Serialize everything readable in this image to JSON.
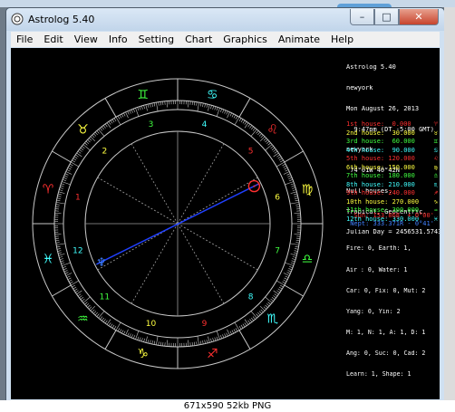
{
  "window": {
    "title": "Astrolog 5.40",
    "buttons": {
      "minimize": "–",
      "maximize": "□",
      "close": "✕"
    }
  },
  "menu": [
    "File",
    "Edit",
    "View",
    "Info",
    "Setting",
    "Chart",
    "Graphics",
    "Animate",
    "Help"
  ],
  "info_lines": [
    "Astrolog 5.40",
    "newyork",
    "Mon August 26, 2013",
    "  9:47pm (DT -5:00 GMT)",
    "newyork",
    " 74°01W 40°42N",
    "Null houses.",
    "Tropical, Geocentric.",
    "Julian Day = 2456531.5743"
  ],
  "houses": [
    {
      "label": "1st house:  ",
      "value": "0.000",
      "color": "#ff3030",
      "sym": "♈"
    },
    {
      "label": "2nd house:  ",
      "value": "30.000",
      "color": "#ffff40",
      "sym": "♉"
    },
    {
      "label": "3rd house:  ",
      "value": "60.000",
      "color": "#40ff40",
      "sym": "♊"
    },
    {
      "label": "4th house:  ",
      "value": "90.000",
      "color": "#40ffff",
      "sym": "♋"
    },
    {
      "label": "5th house: ",
      "value": "120.000",
      "color": "#ff3030",
      "sym": "♌"
    },
    {
      "label": "6th house: ",
      "value": "150.000",
      "color": "#ffff40",
      "sym": "♍"
    },
    {
      "label": "7th house: ",
      "value": "180.000",
      "color": "#40ff40",
      "sym": "♎"
    },
    {
      "label": "8th house: ",
      "value": "210.000",
      "color": "#40ffff",
      "sym": "♏"
    },
    {
      "label": "9th house: ",
      "value": "240.000",
      "color": "#ff3030",
      "sym": "♐"
    },
    {
      "label": "10th house: ",
      "value": "270.000",
      "color": "#ffff40",
      "sym": "♑"
    },
    {
      "label": "11th house: ",
      "value": "300.000",
      "color": "#40ff40",
      "sym": "♒"
    },
    {
      "label": "12th house: ",
      "value": "330.000",
      "color": "#40ffff",
      "sym": "♓"
    }
  ],
  "planets": [
    {
      "text": "  Sun: 153.868  + 0°00'",
      "color": "#ff3030"
    },
    {
      "text": " Nept: 333.371R - 0°41'",
      "color": "#4080ff"
    }
  ],
  "stats": [
    "Fire: 0, Earth: 1,",
    "Air : 0, Water: 1",
    "Car: 0, Fix: 0, Mut: 2",
    "Yang: 0, Yin: 2",
    "M: 1, N: 1, A: 1, D: 1",
    "Ang: 0, Suc: 0, Cad: 2",
    "Learn: 1, Shape: 1"
  ],
  "wheel": {
    "signs": [
      "♈",
      "♉",
      "♊",
      "♋",
      "♌",
      "♍",
      "♎",
      "♏",
      "♐",
      "♑",
      "♒",
      "♓"
    ],
    "sign_colors": [
      "#ff3030",
      "#ffff40",
      "#40ff40",
      "#40ffff",
      "#ff3030",
      "#ffff40",
      "#40ff40",
      "#40ffff",
      "#ff3030",
      "#ffff40",
      "#40ff40",
      "#40ffff"
    ],
    "house_numbers": [
      "1",
      "2",
      "3",
      "4",
      "5",
      "6",
      "7",
      "8",
      "9",
      "10",
      "11",
      "12"
    ],
    "planet_glyphs": {
      "sun": "☉",
      "neptune": "♆"
    }
  },
  "caption": "671x590  52kb  PNG"
}
